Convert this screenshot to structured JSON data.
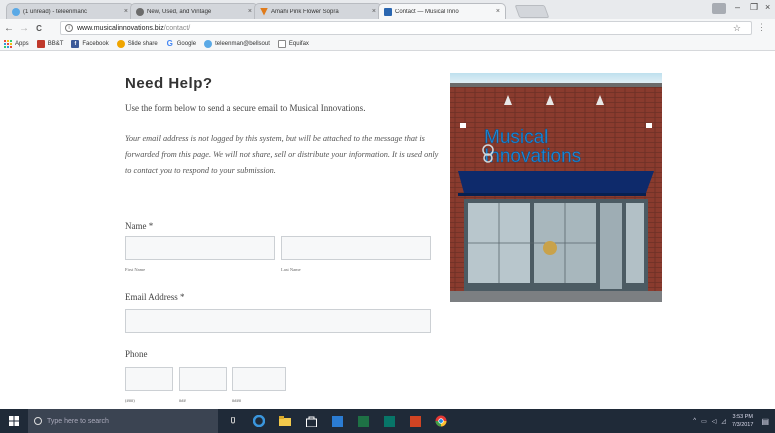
{
  "browser": {
    "tabs": [
      {
        "title": "(1 unread) - teleenmanc",
        "fav_color": "#5aa9e6"
      },
      {
        "title": "New, Used, and Vintage",
        "fav_color": "#6b6b6b"
      },
      {
        "title": "Amahi Pink Flower Sopra",
        "fav_color": "#e07b1a"
      },
      {
        "title": "Contact — Musical Inno",
        "fav_color": "#2a66b0"
      }
    ],
    "tab_close_glyph": "×",
    "window_controls": {
      "minimize": "–",
      "maximize": "❐",
      "close": "×"
    },
    "nav": {
      "back": "←",
      "forward": "→",
      "reload": "C"
    },
    "url_host": "www.musicalinnovations.biz",
    "url_path": "/contact/",
    "star_glyph": "☆",
    "ext_glyph": "⋮",
    "bookmarks": [
      {
        "label": "Apps",
        "icon": "apps-grid-icon",
        "color": "#e74c3c"
      },
      {
        "label": "BB&T",
        "icon": "bbt-icon",
        "color": "#c0392b"
      },
      {
        "label": "Facebook",
        "icon": "facebook-icon",
        "color": "#3b5998"
      },
      {
        "label": "Slide share",
        "icon": "slideshare-icon",
        "color": "#0aa"
      },
      {
        "label": "Google",
        "icon": "google-icon",
        "color": "#4285f4"
      },
      {
        "label": "teleenman@bellsout",
        "icon": "mail-icon",
        "color": "#5aa9e6"
      },
      {
        "label": "Equifax",
        "icon": "document-icon",
        "color": "#888"
      }
    ]
  },
  "page": {
    "title": "Need Help?",
    "intro": "Use the form below to send a secure email to Musical Innovations.",
    "notice": "Your email address is not logged by this system, but will be attached to the message that is forwarded from this page. We will not share, sell or distribute your information. It is used only to contact you to respond to your submission.",
    "name_label": "Name *",
    "first_name_sub": "First Name",
    "last_name_sub": "Last Name",
    "email_label": "Email Address *",
    "phone_label": "Phone",
    "phone_subs": [
      "(###)",
      "###",
      "####"
    ],
    "store_sign_line1": "Musical",
    "store_sign_line2": "Innovations"
  },
  "taskbar": {
    "search_placeholder": "Type here to search",
    "time": "3:53 PM",
    "date": "7/3/2017"
  }
}
